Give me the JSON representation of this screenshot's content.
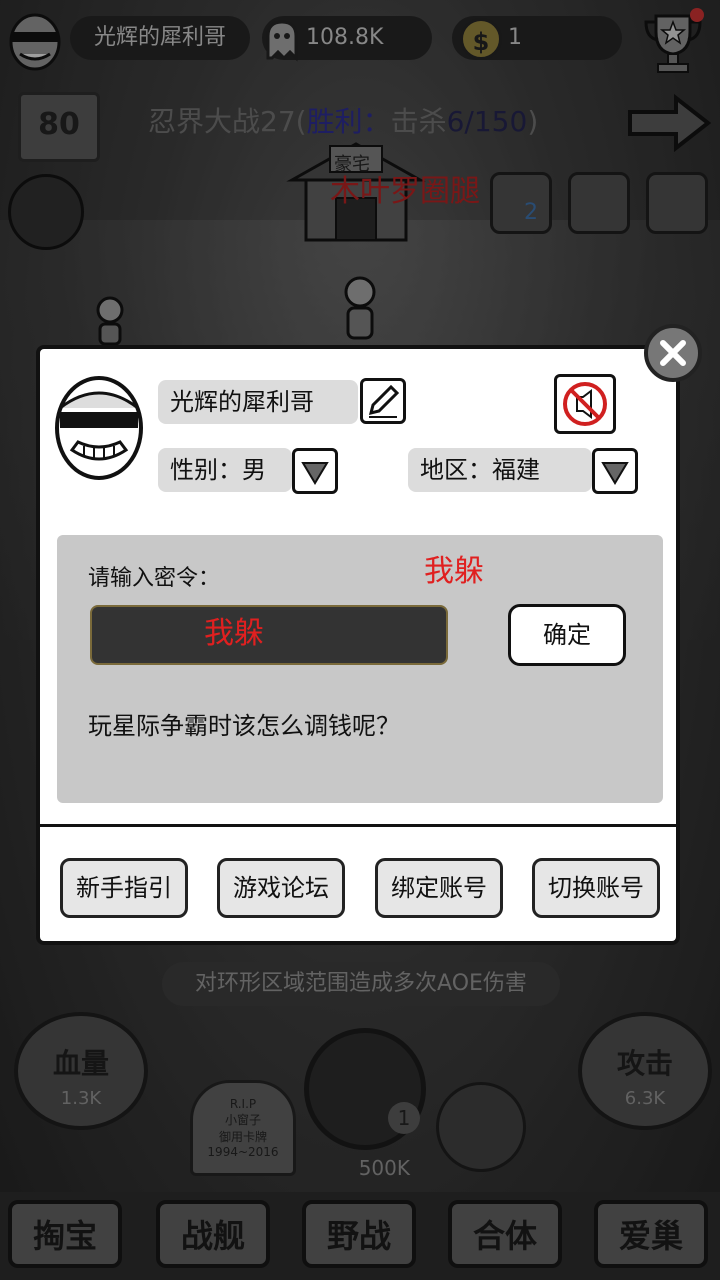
{
  "top_bar": {
    "player_name": "光辉的犀利哥",
    "souls": "108.8K",
    "coins": "1"
  },
  "battle": {
    "level": "80",
    "stage": "忍界大战27",
    "paren_open": "(",
    "win_label": "胜利：",
    "kill_label": "击杀",
    "kill_count": "6/150",
    "paren_close": ")",
    "location": "木叶罗圈腿",
    "house_sign": "豪宅",
    "skill_count": "2"
  },
  "bottom": {
    "skill_desc": "对环形区域范围造成多次AOE伤害",
    "hp_label": "血量",
    "hp_value": "1.3K",
    "atk_label": "攻击",
    "atk_value": "6.3K",
    "tomb_text": "R.I.P",
    "tomb_name": "小窗子",
    "tomb_sub": "御用卡牌",
    "tomb_years": "1994~2016",
    "cost": "500K",
    "count": "1",
    "nav": [
      "掏宝",
      "战舰",
      "野战",
      "合体",
      "爱巢"
    ]
  },
  "dialog": {
    "name": "光辉的犀利哥",
    "gender": "性别：男",
    "region": "地区：福建",
    "prompt_label": "请输入密令：",
    "red_overlay_1": "我躲",
    "red_overlay_2": "我躲",
    "confirm": "确定",
    "hint": "玩星际争霸时该怎么调钱呢？",
    "buttons": [
      "新手指引",
      "游戏论坛",
      "绑定账号",
      "切换账号"
    ]
  }
}
